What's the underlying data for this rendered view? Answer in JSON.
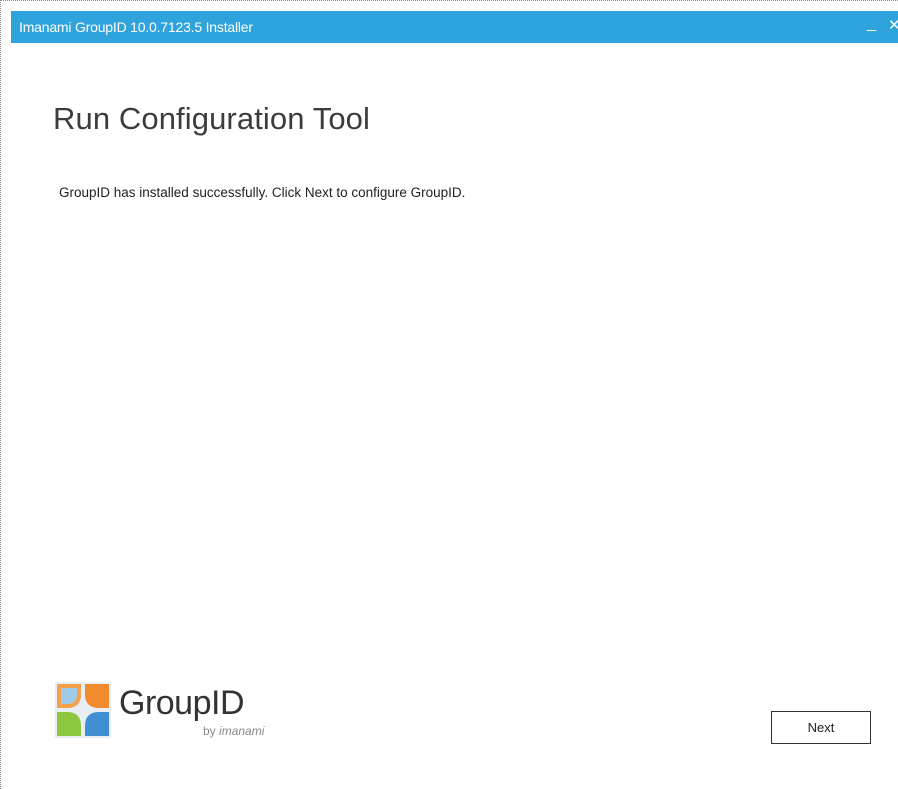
{
  "window": {
    "title": "Imanami GroupID 10.0.7123.5 Installer",
    "minimize_glyph": "_",
    "close_glyph": "✕"
  },
  "page": {
    "heading": "Run Configuration Tool",
    "message": "GroupID has installed successfully. Click Next to configure GroupID."
  },
  "logo": {
    "wordmark": "GroupID",
    "byline_prefix": "by",
    "byline_brand": "imanami",
    "icon": "groupid-pinwheel-icon",
    "colors": {
      "orange": "#f28a2e",
      "green": "#8dc63f",
      "blue": "#3f8fd2",
      "light_blue": "#9fcbe9"
    }
  },
  "footer": {
    "next_label": "Next"
  },
  "colors": {
    "titlebar": "#2fa3dc",
    "title_text": "#ffffff",
    "heading_text": "#3c3c3c"
  }
}
